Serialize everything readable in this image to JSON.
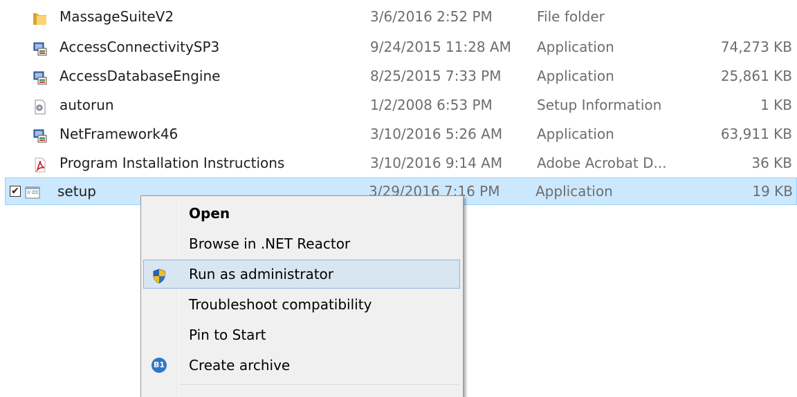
{
  "files": [
    {
      "name": "MassageSuiteV2",
      "date": "3/6/2016 2:52 PM",
      "type": "File folder",
      "size": "",
      "icon": "folder-icon"
    },
    {
      "name": "AccessConnectivitySP3",
      "date": "9/24/2015 11:28 AM",
      "type": "Application",
      "size": "74,273 KB",
      "icon": "installer-icon"
    },
    {
      "name": "AccessDatabaseEngine",
      "date": "8/25/2015 7:33 PM",
      "type": "Application",
      "size": "25,861 KB",
      "icon": "installer-icon"
    },
    {
      "name": "autorun",
      "date": "1/2/2008 6:53 PM",
      "type": "Setup Information",
      "size": "1 KB",
      "icon": "setup-info-icon"
    },
    {
      "name": "NetFramework46",
      "date": "3/10/2016 5:26 AM",
      "type": "Application",
      "size": "63,911 KB",
      "icon": "installer-icon"
    },
    {
      "name": "Program Installation Instructions",
      "date": "3/10/2016 9:14 AM",
      "type": "Adobe Acrobat D...",
      "size": "36 KB",
      "icon": "pdf-icon"
    },
    {
      "name": "setup",
      "date": "3/29/2016 7:16 PM",
      "type": "Application",
      "size": "19 KB",
      "icon": "app-window-icon",
      "selected": true,
      "checked": true
    }
  ],
  "checkmark": "✔",
  "context_menu": {
    "items": [
      {
        "label": "Open",
        "bold": true,
        "icon": ""
      },
      {
        "label": "Browse in .NET Reactor",
        "icon": ""
      },
      {
        "label": "Run as administrator",
        "icon": "uac-shield-icon",
        "hover": true
      },
      {
        "label": "Troubleshoot compatibility",
        "icon": ""
      },
      {
        "label": "Pin to Start",
        "icon": ""
      },
      {
        "label": "Create archive",
        "icon": "b1-archiver-icon",
        "icon_text": "B1"
      }
    ]
  },
  "colors": {
    "selection_bg": "#cce8ff",
    "selection_border": "#99d1ff",
    "menu_bg": "#f0f0f0",
    "menu_hover_bg": "#d8e6f2",
    "menu_hover_border": "#8fb4d9",
    "secondary_text": "#6d6d6d"
  }
}
